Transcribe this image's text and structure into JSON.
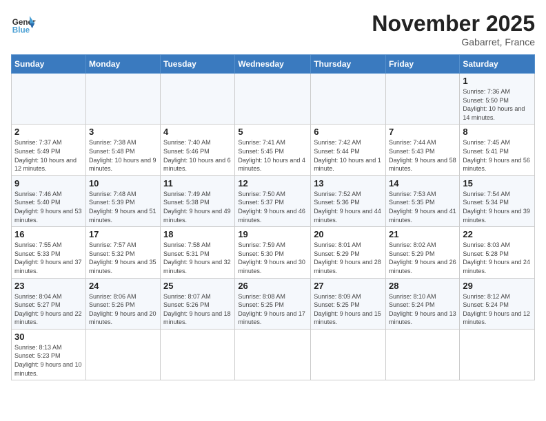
{
  "header": {
    "logo_general": "General",
    "logo_blue": "Blue",
    "title": "November 2025",
    "location": "Gabarret, France"
  },
  "days_of_week": [
    "Sunday",
    "Monday",
    "Tuesday",
    "Wednesday",
    "Thursday",
    "Friday",
    "Saturday"
  ],
  "weeks": [
    [
      {
        "day": "",
        "info": ""
      },
      {
        "day": "",
        "info": ""
      },
      {
        "day": "",
        "info": ""
      },
      {
        "day": "",
        "info": ""
      },
      {
        "day": "",
        "info": ""
      },
      {
        "day": "",
        "info": ""
      },
      {
        "day": "1",
        "info": "Sunrise: 7:36 AM\nSunset: 5:50 PM\nDaylight: 10 hours and 14 minutes."
      }
    ],
    [
      {
        "day": "2",
        "info": "Sunrise: 7:37 AM\nSunset: 5:49 PM\nDaylight: 10 hours and 12 minutes."
      },
      {
        "day": "3",
        "info": "Sunrise: 7:38 AM\nSunset: 5:48 PM\nDaylight: 10 hours and 9 minutes."
      },
      {
        "day": "4",
        "info": "Sunrise: 7:40 AM\nSunset: 5:46 PM\nDaylight: 10 hours and 6 minutes."
      },
      {
        "day": "5",
        "info": "Sunrise: 7:41 AM\nSunset: 5:45 PM\nDaylight: 10 hours and 4 minutes."
      },
      {
        "day": "6",
        "info": "Sunrise: 7:42 AM\nSunset: 5:44 PM\nDaylight: 10 hours and 1 minute."
      },
      {
        "day": "7",
        "info": "Sunrise: 7:44 AM\nSunset: 5:43 PM\nDaylight: 9 hours and 58 minutes."
      },
      {
        "day": "8",
        "info": "Sunrise: 7:45 AM\nSunset: 5:41 PM\nDaylight: 9 hours and 56 minutes."
      }
    ],
    [
      {
        "day": "9",
        "info": "Sunrise: 7:46 AM\nSunset: 5:40 PM\nDaylight: 9 hours and 53 minutes."
      },
      {
        "day": "10",
        "info": "Sunrise: 7:48 AM\nSunset: 5:39 PM\nDaylight: 9 hours and 51 minutes."
      },
      {
        "day": "11",
        "info": "Sunrise: 7:49 AM\nSunset: 5:38 PM\nDaylight: 9 hours and 49 minutes."
      },
      {
        "day": "12",
        "info": "Sunrise: 7:50 AM\nSunset: 5:37 PM\nDaylight: 9 hours and 46 minutes."
      },
      {
        "day": "13",
        "info": "Sunrise: 7:52 AM\nSunset: 5:36 PM\nDaylight: 9 hours and 44 minutes."
      },
      {
        "day": "14",
        "info": "Sunrise: 7:53 AM\nSunset: 5:35 PM\nDaylight: 9 hours and 41 minutes."
      },
      {
        "day": "15",
        "info": "Sunrise: 7:54 AM\nSunset: 5:34 PM\nDaylight: 9 hours and 39 minutes."
      }
    ],
    [
      {
        "day": "16",
        "info": "Sunrise: 7:55 AM\nSunset: 5:33 PM\nDaylight: 9 hours and 37 minutes."
      },
      {
        "day": "17",
        "info": "Sunrise: 7:57 AM\nSunset: 5:32 PM\nDaylight: 9 hours and 35 minutes."
      },
      {
        "day": "18",
        "info": "Sunrise: 7:58 AM\nSunset: 5:31 PM\nDaylight: 9 hours and 32 minutes."
      },
      {
        "day": "19",
        "info": "Sunrise: 7:59 AM\nSunset: 5:30 PM\nDaylight: 9 hours and 30 minutes."
      },
      {
        "day": "20",
        "info": "Sunrise: 8:01 AM\nSunset: 5:29 PM\nDaylight: 9 hours and 28 minutes."
      },
      {
        "day": "21",
        "info": "Sunrise: 8:02 AM\nSunset: 5:29 PM\nDaylight: 9 hours and 26 minutes."
      },
      {
        "day": "22",
        "info": "Sunrise: 8:03 AM\nSunset: 5:28 PM\nDaylight: 9 hours and 24 minutes."
      }
    ],
    [
      {
        "day": "23",
        "info": "Sunrise: 8:04 AM\nSunset: 5:27 PM\nDaylight: 9 hours and 22 minutes."
      },
      {
        "day": "24",
        "info": "Sunrise: 8:06 AM\nSunset: 5:26 PM\nDaylight: 9 hours and 20 minutes."
      },
      {
        "day": "25",
        "info": "Sunrise: 8:07 AM\nSunset: 5:26 PM\nDaylight: 9 hours and 18 minutes."
      },
      {
        "day": "26",
        "info": "Sunrise: 8:08 AM\nSunset: 5:25 PM\nDaylight: 9 hours and 17 minutes."
      },
      {
        "day": "27",
        "info": "Sunrise: 8:09 AM\nSunset: 5:25 PM\nDaylight: 9 hours and 15 minutes."
      },
      {
        "day": "28",
        "info": "Sunrise: 8:10 AM\nSunset: 5:24 PM\nDaylight: 9 hours and 13 minutes."
      },
      {
        "day": "29",
        "info": "Sunrise: 8:12 AM\nSunset: 5:24 PM\nDaylight: 9 hours and 12 minutes."
      }
    ],
    [
      {
        "day": "30",
        "info": "Sunrise: 8:13 AM\nSunset: 5:23 PM\nDaylight: 9 hours and 10 minutes."
      },
      {
        "day": "",
        "info": ""
      },
      {
        "day": "",
        "info": ""
      },
      {
        "day": "",
        "info": ""
      },
      {
        "day": "",
        "info": ""
      },
      {
        "day": "",
        "info": ""
      },
      {
        "day": "",
        "info": ""
      }
    ]
  ]
}
